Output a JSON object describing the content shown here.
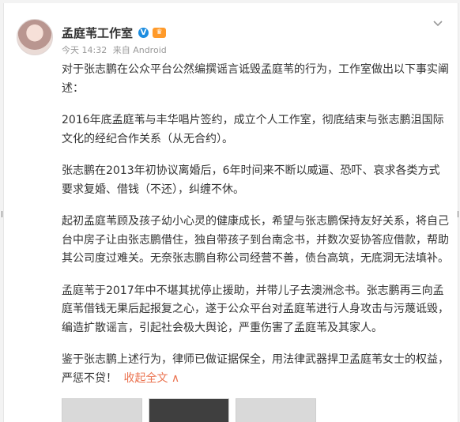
{
  "post": {
    "author": "孟庭苇工作室",
    "verified_icon": "verified-badge-icon",
    "vip_icon": "vip-crown-icon",
    "time": "今天 14:32",
    "source": "来自 Android",
    "menu_icon": "chevron-down-icon",
    "paragraphs": [
      "对于张志鹏在公众平台公然编撰谣言诋毁孟庭苇的行为，工作室做出以下事实阐述：",
      "2016年底孟庭苇与丰华唱片签约，成立个人工作室，彻底结束与张志鹏沮国际文化的经纪合作关系（从无合约）。",
      "张志鹏在2013年初协议离婚后，6年时间来不断以威逼、恐吓、哀求各类方式要求复婚、借钱（不还），纠缠不休。",
      "起初孟庭苇顾及孩子幼小心灵的健康成长，希望与张志鹏保持友好关系，将自己台中房子让由张志鹏借住，独自带孩子到台南念书，并数次妥协答应借款，帮助其公司度过难关。无奈张志鹏自称公司经营不善，债台高筑，无底洞无法填补。",
      "孟庭苇于2017年中不堪其扰停止援助，并带儿子去澳洲念书。张志鹏再三向孟庭苇借钱无果后起报复之心，遂于公众平台对孟庭苇进行人身攻击与污蔑诋毁，编造扩散谣言，引起社会极大舆论，严重伤害了孟庭苇及其家人。"
    ],
    "last_paragraph": "鉴于张志鹏上述行为，律师已做证据保全，用法律武器捍卫孟庭苇女士的权益，严惩不贷！",
    "collapse_label": "收起全文 ∧",
    "accent_color": "#eb7350"
  }
}
